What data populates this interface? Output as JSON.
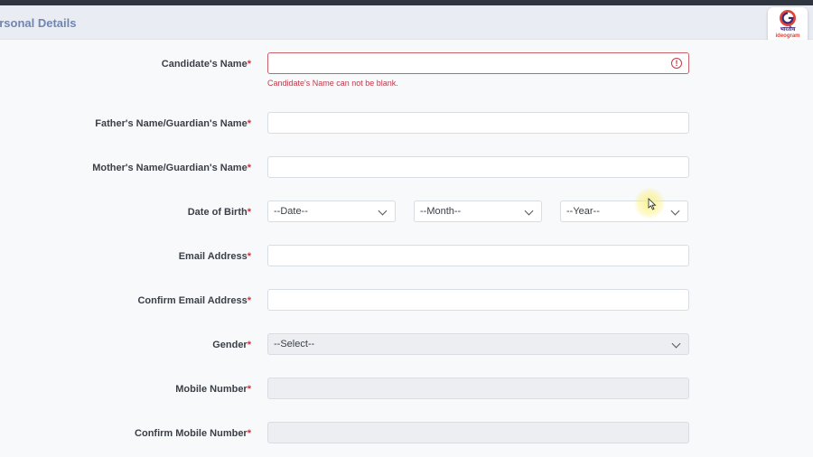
{
  "section": {
    "title": "ersonal Details"
  },
  "logo": {
    "name": "भारतीय",
    "sub": "ideogram"
  },
  "form": {
    "candidate_name": {
      "label": "Candidate's Name",
      "value": "",
      "error": "Candidate's Name can not be blank."
    },
    "father_name": {
      "label": "Father's Name/Guardian's Name",
      "value": ""
    },
    "mother_name": {
      "label": "Mother's Name/Guardian's Name",
      "value": ""
    },
    "dob": {
      "label": "Date of Birth",
      "date": "--Date--",
      "month": "--Month--",
      "year": "--Year--"
    },
    "email": {
      "label": "Email Address",
      "value": ""
    },
    "confirm_email": {
      "label": "Confirm Email Address",
      "value": ""
    },
    "gender": {
      "label": "Gender",
      "selected": "--Select--"
    },
    "mobile": {
      "label": "Mobile Number",
      "value": ""
    },
    "confirm_mobile": {
      "label": "Confirm Mobile Number",
      "value": ""
    },
    "required_marker": "*"
  },
  "colors": {
    "accent": "#6f86b3",
    "error": "#c0394a",
    "required": "#d0323b"
  }
}
